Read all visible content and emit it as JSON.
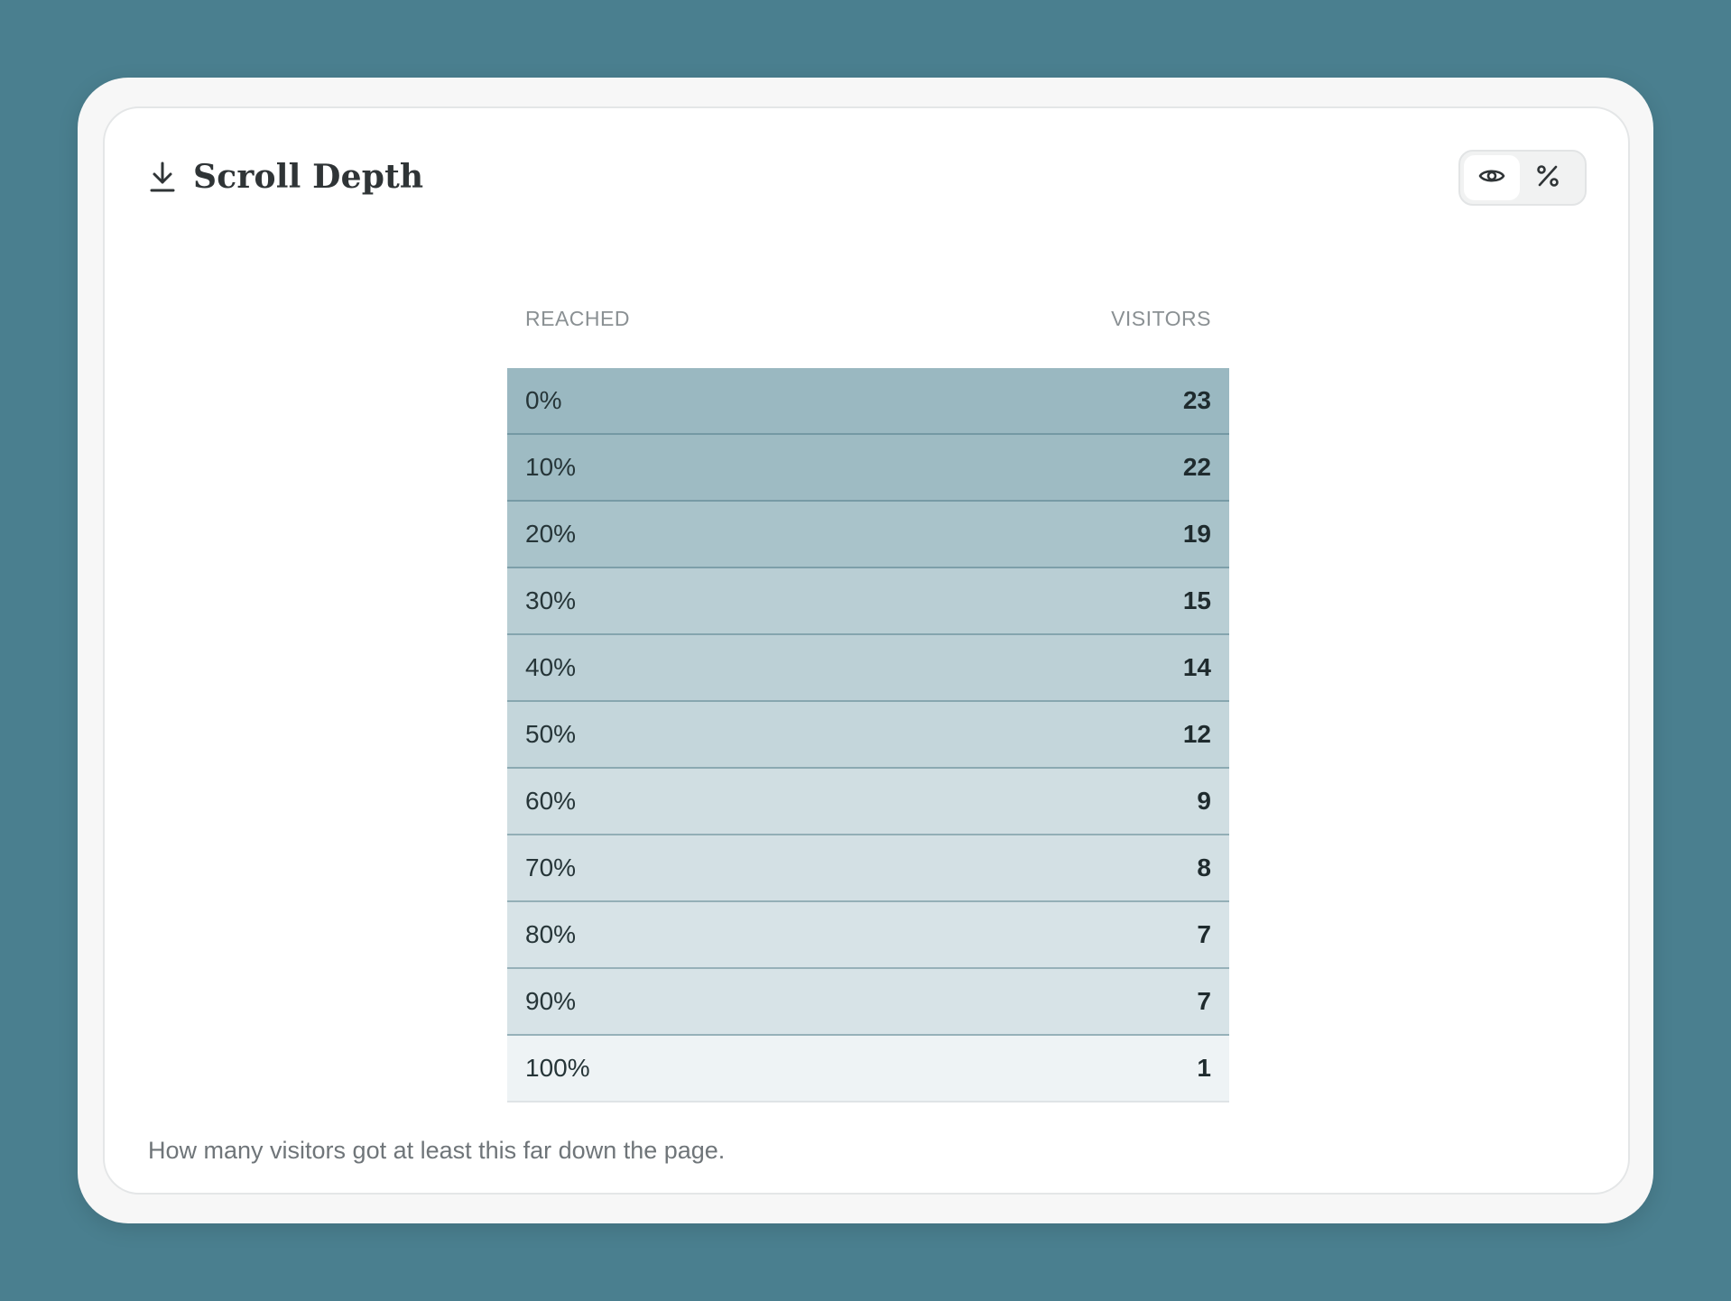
{
  "header": {
    "title": "Scroll Depth",
    "icon": "download-icon"
  },
  "toggles": [
    {
      "name": "eye-icon",
      "active": true
    },
    {
      "name": "percent-icon",
      "active": false
    }
  ],
  "table": {
    "headers": {
      "reached": "REACHED",
      "visitors": "VISITORS"
    },
    "rows": [
      {
        "reached": "0%",
        "visitors": "23"
      },
      {
        "reached": "10%",
        "visitors": "22"
      },
      {
        "reached": "20%",
        "visitors": "19"
      },
      {
        "reached": "30%",
        "visitors": "15"
      },
      {
        "reached": "40%",
        "visitors": "14"
      },
      {
        "reached": "50%",
        "visitors": "12"
      },
      {
        "reached": "60%",
        "visitors": "9"
      },
      {
        "reached": "70%",
        "visitors": "8"
      },
      {
        "reached": "80%",
        "visitors": "7"
      },
      {
        "reached": "90%",
        "visitors": "7"
      },
      {
        "reached": "100%",
        "visitors": "1"
      }
    ]
  },
  "caption": "How many visitors got at least this far down the page.",
  "colors": {
    "background": "#4a7f8f",
    "row_fill_max": "#9ab8c1",
    "row_fill_min": "#f2f6f7"
  }
}
